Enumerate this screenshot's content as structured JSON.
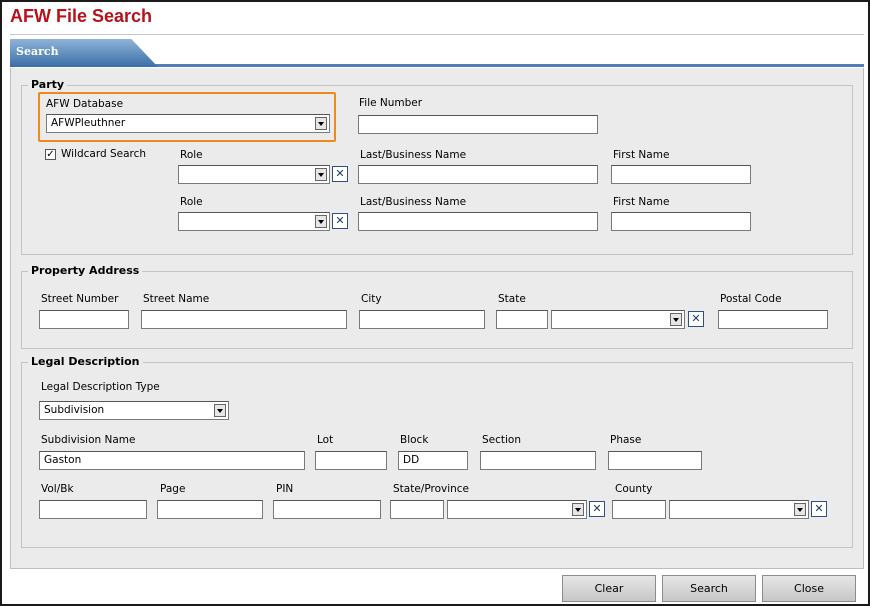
{
  "header": {
    "title": "AFW File Search"
  },
  "tabs": [
    {
      "label": "Search"
    }
  ],
  "party": {
    "legend": "Party",
    "afw_database_label": "AFW Database",
    "afw_database_value": "AFWPleuthner",
    "file_number_label": "File Number",
    "file_number_value": "",
    "wildcard_label": "Wildcard Search",
    "wildcard_checked": "✓",
    "rows": [
      {
        "role_label": "Role",
        "role_value": "",
        "last_label": "Last/Business Name",
        "last_value": "",
        "first_label": "First Name",
        "first_value": ""
      },
      {
        "role_label": "Role",
        "role_value": "",
        "last_label": "Last/Business Name",
        "last_value": "",
        "first_label": "First Name",
        "first_value": ""
      }
    ]
  },
  "property": {
    "legend": "Property Address",
    "street_number_label": "Street Number",
    "street_name_label": "Street Name",
    "city_label": "City",
    "state_label": "State",
    "postal_code_label": "Postal Code",
    "values": {
      "street_number": "",
      "street_name": "",
      "city": "",
      "state_code": "",
      "state": "",
      "postal_code": ""
    }
  },
  "legal": {
    "legend": "Legal Description",
    "type_label": "Legal Description Type",
    "type_value": "Subdivision",
    "subdivision_name_label": "Subdivision Name",
    "subdivision_name_value": "Gaston",
    "lot_label": "Lot",
    "lot_value": "",
    "block_label": "Block",
    "block_value": "DD",
    "section_label": "Section",
    "section_value": "",
    "phase_label": "Phase",
    "phase_value": "",
    "volbk_label": "Vol/Bk",
    "page_label": "Page",
    "pin_label": "PIN",
    "state_province_label": "State/Province",
    "county_label": "County",
    "clear_glyph": "✕"
  },
  "footer": {
    "clear_label": "Clear",
    "search_label": "Search",
    "close_label": "Close"
  }
}
